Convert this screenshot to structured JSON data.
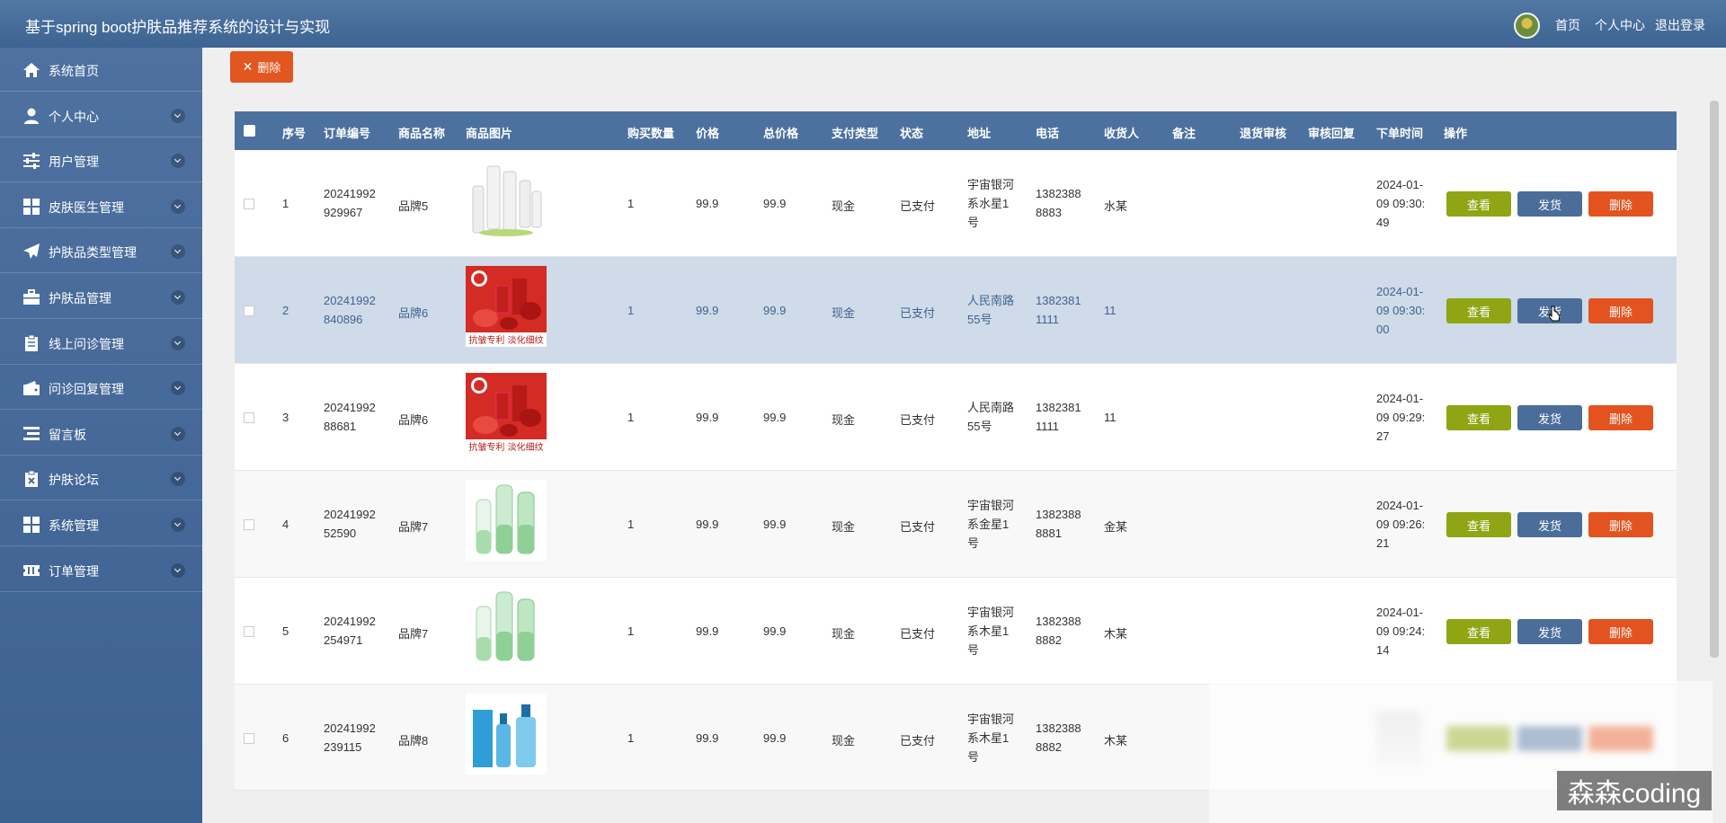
{
  "header": {
    "title": "基于spring boot护肤品推荐系统的设计与实现",
    "nav": [
      "首页",
      "个人中心",
      "退出登录"
    ]
  },
  "sidebar": {
    "items": [
      {
        "label": "系统首页",
        "icon": "home-icon",
        "chevron": false
      },
      {
        "label": "个人中心",
        "icon": "user-icon",
        "chevron": true
      },
      {
        "label": "用户管理",
        "icon": "sliders-icon",
        "chevron": true
      },
      {
        "label": "皮肤医生管理",
        "icon": "grid-icon",
        "chevron": true
      },
      {
        "label": "护肤品类型管理",
        "icon": "paper-plane-icon",
        "chevron": true
      },
      {
        "label": "护肤品管理",
        "icon": "briefcase-icon",
        "chevron": true
      },
      {
        "label": "线上问诊管理",
        "icon": "clipboard-icon",
        "chevron": true
      },
      {
        "label": "问诊回复管理",
        "icon": "wallet-icon",
        "chevron": true
      },
      {
        "label": "留言板",
        "icon": "list-icon",
        "chevron": true
      },
      {
        "label": "护肤论坛",
        "icon": "clipboard-x-icon",
        "chevron": true
      },
      {
        "label": "系统管理",
        "icon": "grid-icon",
        "chevron": true
      },
      {
        "label": "订单管理",
        "icon": "ticket-icon",
        "chevron": true
      }
    ]
  },
  "toolbar": {
    "delete_label": "删除"
  },
  "table": {
    "columns": [
      "序号",
      "订单编号",
      "商品名称",
      "商品图片",
      "购买数量",
      "价格",
      "总价格",
      "支付类型",
      "状态",
      "地址",
      "电话",
      "收货人",
      "备注",
      "退货审核",
      "审核回复",
      "下单时间",
      "操作"
    ],
    "actions": {
      "view": "查看",
      "ship": "发货",
      "delete": "删除"
    },
    "rows": [
      {
        "index": "1",
        "order_no": [
          "20241992",
          "929967"
        ],
        "product": "品牌5",
        "image": "white-bottles",
        "qty": "1",
        "price": "99.9",
        "total": "99.9",
        "pay": "现金",
        "status": "已支付",
        "address": [
          "宇宙银河",
          "系水星1",
          "号"
        ],
        "phone": [
          "1382388",
          "8883"
        ],
        "receiver": "水某",
        "time": [
          "2024-01-",
          "09 09:30:",
          "49"
        ]
      },
      {
        "index": "2",
        "order_no": [
          "20241992",
          "840896"
        ],
        "product": "品牌6",
        "image": "red-set",
        "qty": "1",
        "price": "99.9",
        "total": "99.9",
        "pay": "现金",
        "status": "已支付",
        "address": [
          "人民南路",
          "55号"
        ],
        "phone": [
          "1382381",
          "1111"
        ],
        "receiver": "11",
        "time": [
          "2024-01-",
          "09 09:30:",
          "00"
        ]
      },
      {
        "index": "3",
        "order_no": [
          "20241992",
          "88681"
        ],
        "product": "品牌6",
        "image": "red-set",
        "qty": "1",
        "price": "99.9",
        "total": "99.9",
        "pay": "现金",
        "status": "已支付",
        "address": [
          "人民南路",
          "55号"
        ],
        "phone": [
          "1382381",
          "1111"
        ],
        "receiver": "11",
        "time": [
          "2024-01-",
          "09 09:29:",
          "27"
        ]
      },
      {
        "index": "4",
        "order_no": [
          "20241992",
          "52590"
        ],
        "product": "品牌7",
        "image": "green-bottles",
        "qty": "1",
        "price": "99.9",
        "total": "99.9",
        "pay": "现金",
        "status": "已支付",
        "address": [
          "宇宙银河",
          "系金星1",
          "号"
        ],
        "phone": [
          "1382388",
          "8881"
        ],
        "receiver": "金某",
        "time": [
          "2024-01-",
          "09 09:26:",
          "21"
        ]
      },
      {
        "index": "5",
        "order_no": [
          "20241992",
          "254971"
        ],
        "product": "品牌7",
        "image": "green-bottles",
        "qty": "1",
        "price": "99.9",
        "total": "99.9",
        "pay": "现金",
        "status": "已支付",
        "address": [
          "宇宙银河",
          "系木星1",
          "号"
        ],
        "phone": [
          "1382388",
          "8882"
        ],
        "receiver": "木某",
        "time": [
          "2024-01-",
          "09 09:24:",
          "14"
        ]
      },
      {
        "index": "6",
        "order_no": [
          "20241992",
          "239115"
        ],
        "product": "品牌8",
        "image": "blue-bottles",
        "qty": "1",
        "price": "99.9",
        "total": "99.9",
        "pay": "现金",
        "status": "已支付",
        "address": [
          "宇宙银河",
          "系木星1",
          "号"
        ],
        "phone": [
          "1382388",
          "8882"
        ],
        "receiver": "木某",
        "time": [
          "",
          "",
          ""
        ]
      }
    ]
  },
  "red_set_caption": "抗皱专利 淡化细纹",
  "watermark": "森森coding",
  "colors": {
    "header": "#4a6f9c",
    "view": "#8fa513",
    "ship": "#4a6d9a",
    "delete": "#e2531f",
    "highlight_row": "#cfdbe8"
  }
}
